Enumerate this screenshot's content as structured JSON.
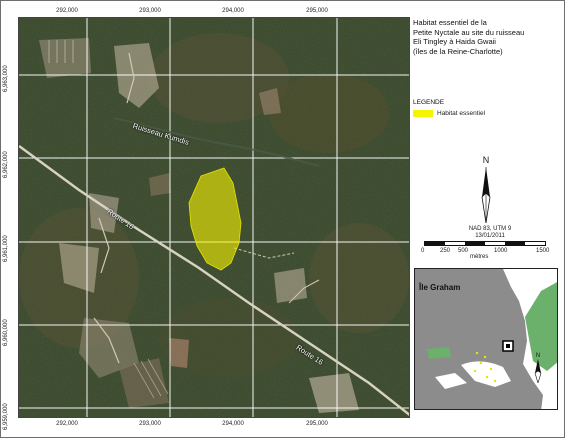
{
  "map": {
    "title_lines": [
      "Habitat essentiel de la",
      "Petite Nyctale au site du ruisseau",
      "Eli Tingley à Haida Gwaii",
      "(îles de la Reine-Charlotte)"
    ],
    "legend_title": "LEGENDE",
    "legend_item_label": "Habitat essentiel",
    "legend_item_color": "#f6f400",
    "x_ticks": [
      "292,000",
      "293,000",
      "294,000",
      "295,000"
    ],
    "x_ticks_bottom": [
      "292,000",
      "293,000",
      "294,000",
      "295,000"
    ],
    "y_ticks": [
      "6,963,000",
      "6,962,000",
      "6,961,000",
      "6,960,000",
      "6,959,000"
    ],
    "creek_label": "Ruisseau Kumdis",
    "road_label_1": "Route 16",
    "road_label_2": "Route 16",
    "north_letter": "N",
    "projection": "NAD 83, UTM 9",
    "date": "13/01/2011",
    "scale_labels": [
      "0",
      "250",
      "500",
      "1000",
      "1500"
    ],
    "scale_unit": "mètres",
    "inset_label": "Île Graham",
    "inset_north_letter": "N"
  }
}
